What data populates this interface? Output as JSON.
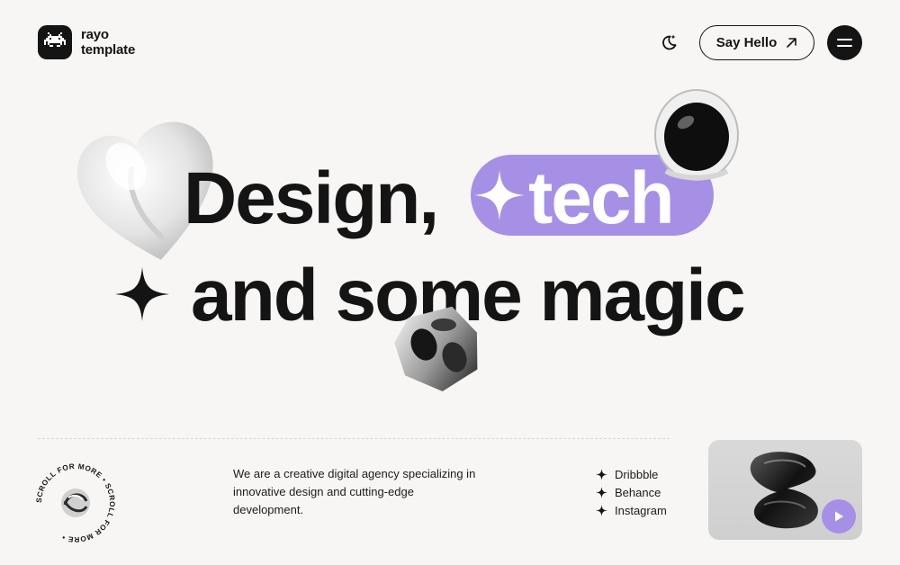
{
  "brand": {
    "line1": "rayo",
    "line2": "template"
  },
  "header": {
    "say_hello_label": "Say Hello"
  },
  "hero": {
    "line1_prefix": "Design,",
    "highlight": "tech",
    "line2": "and some magic"
  },
  "badge": {
    "text": "SCROLL FOR MORE • SCROLL FOR MORE • "
  },
  "about": {
    "description": "We are a creative digital agency specializing in innovative design and cutting-edge development."
  },
  "socials": [
    {
      "label": "Dribbble"
    },
    {
      "label": "Behance"
    },
    {
      "label": "Instagram"
    }
  ],
  "colors": {
    "accent": "#a690e6",
    "ink": "#141414",
    "background": "#f8f6f4"
  }
}
